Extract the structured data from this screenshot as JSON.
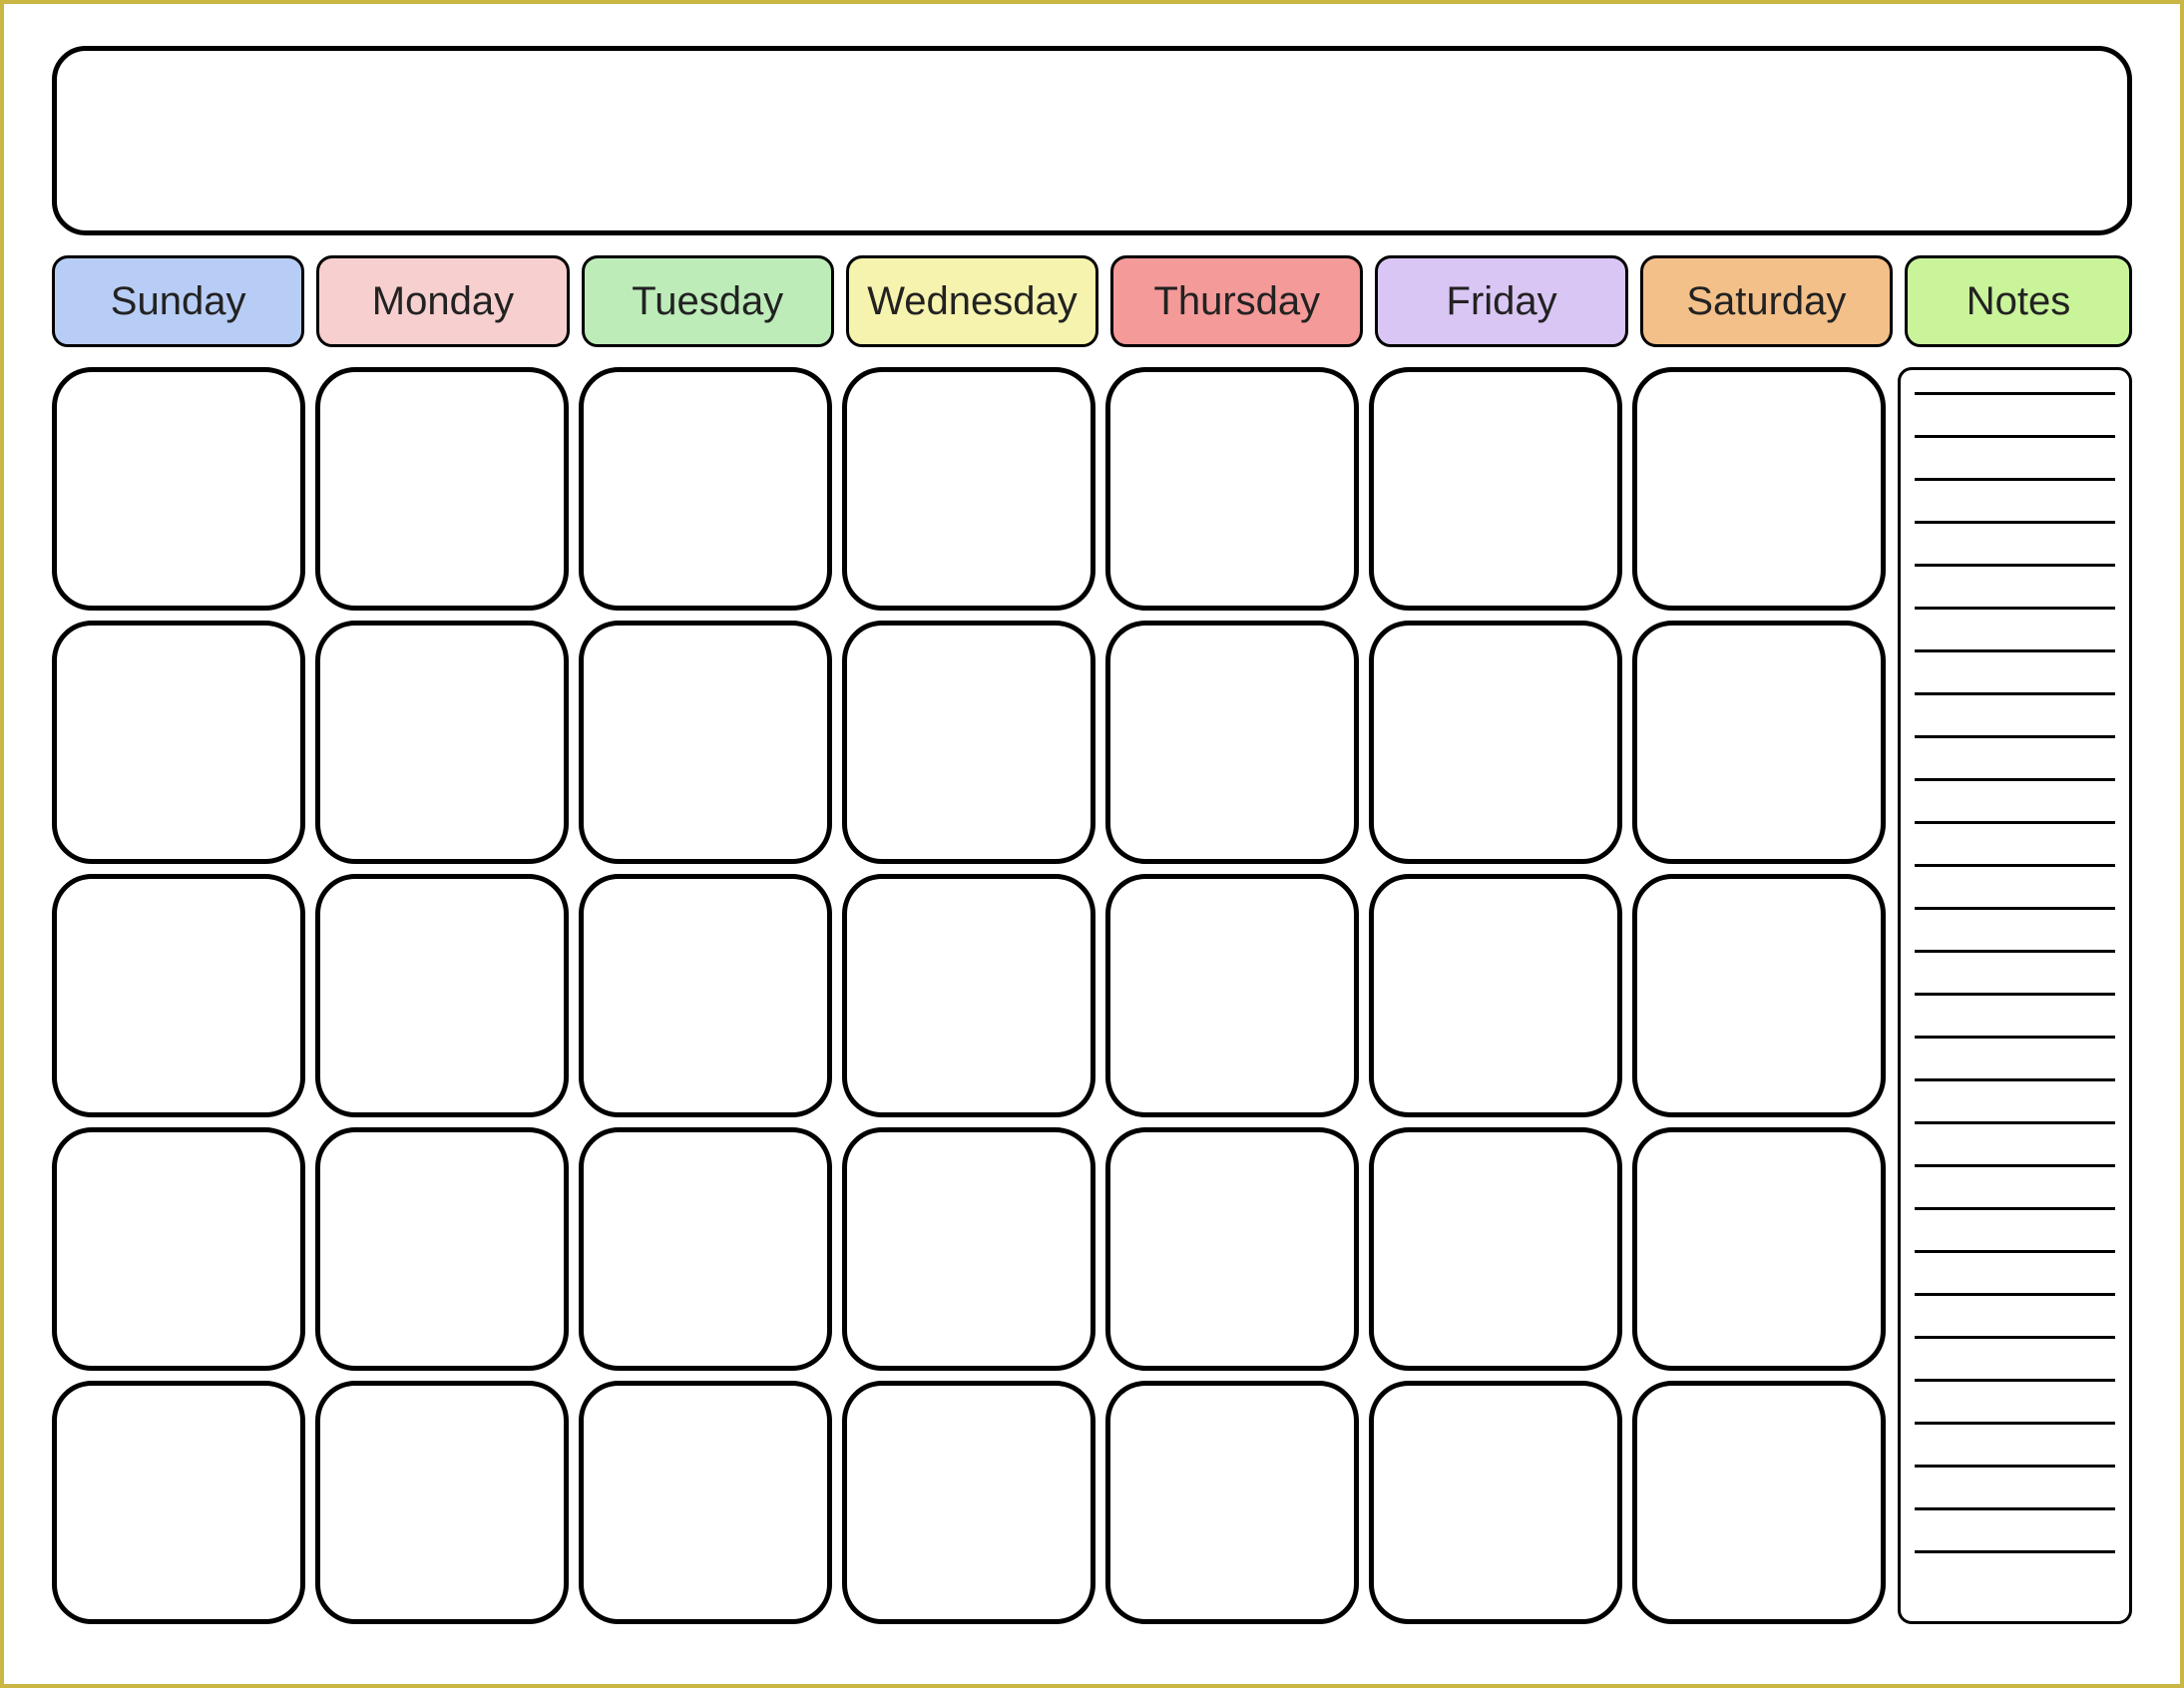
{
  "title": "",
  "columns": [
    {
      "label": "Sunday",
      "color": "#b8cdf5"
    },
    {
      "label": "Monday",
      "color": "#f8cfcf"
    },
    {
      "label": "Tuesday",
      "color": "#bdecb9"
    },
    {
      "label": "Wednesday",
      "color": "#f6f3ae"
    },
    {
      "label": "Thursday",
      "color": "#f49a99"
    },
    {
      "label": "Friday",
      "color": "#d9c6f4"
    },
    {
      "label": "Saturday",
      "color": "#f4c08a"
    },
    {
      "label": "Notes",
      "color": "#c9f49a"
    }
  ],
  "grid": {
    "rows": 5,
    "cols": 7,
    "cells": [
      [
        "",
        "",
        "",
        "",
        "",
        "",
        ""
      ],
      [
        "",
        "",
        "",
        "",
        "",
        "",
        ""
      ],
      [
        "",
        "",
        "",
        "",
        "",
        "",
        ""
      ],
      [
        "",
        "",
        "",
        "",
        "",
        "",
        ""
      ],
      [
        "",
        "",
        "",
        "",
        "",
        "",
        ""
      ]
    ]
  },
  "notes_lines_count": 28,
  "notes_lines": [
    "",
    "",
    "",
    "",
    "",
    "",
    "",
    "",
    "",
    "",
    "",
    "",
    "",
    "",
    "",
    "",
    "",
    "",
    "",
    "",
    "",
    "",
    "",
    "",
    "",
    "",
    "",
    ""
  ]
}
